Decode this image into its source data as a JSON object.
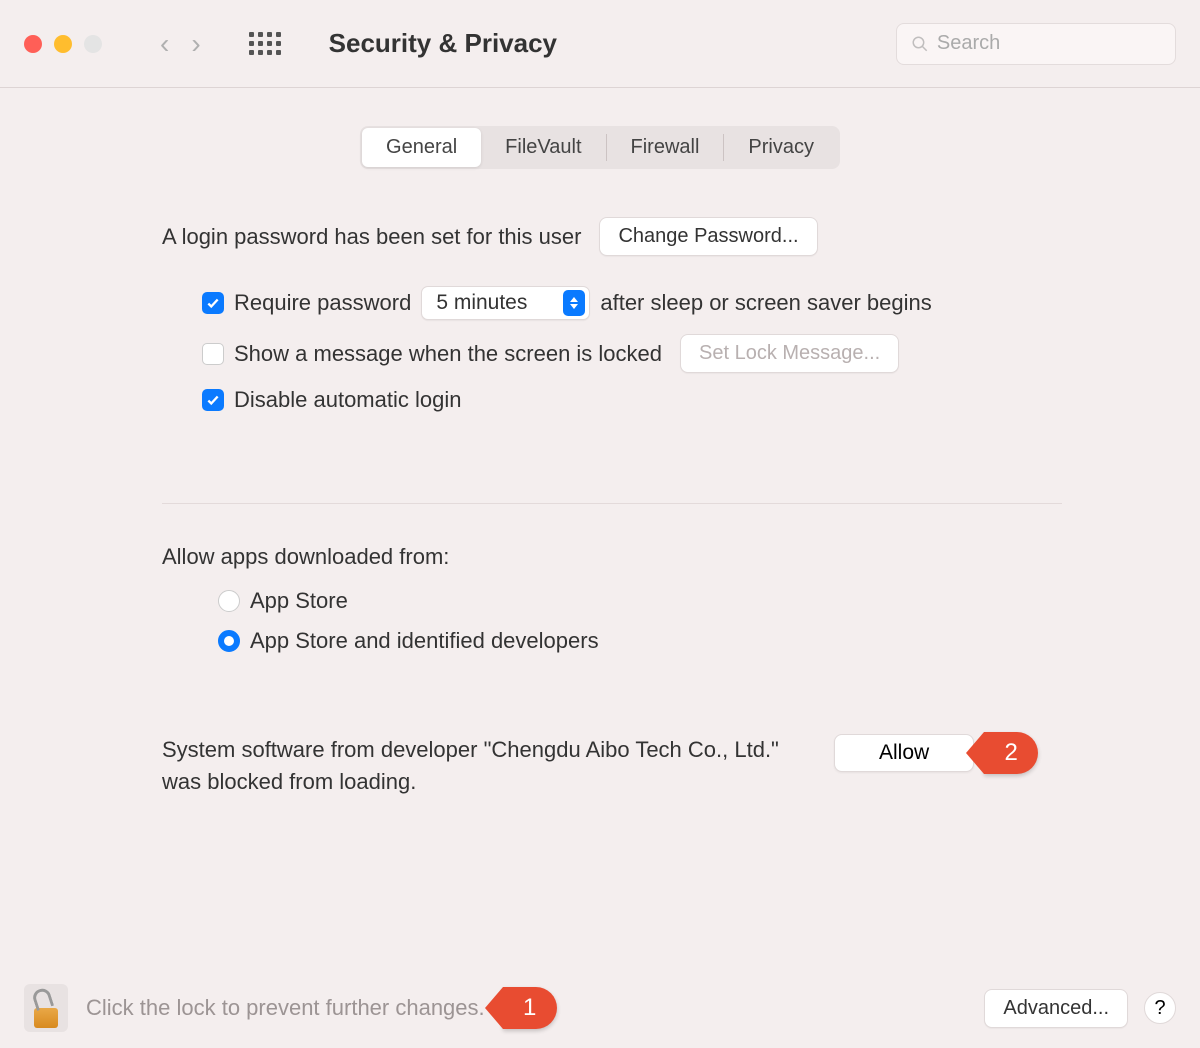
{
  "window": {
    "title": "Security & Privacy",
    "search_placeholder": "Search"
  },
  "tabs": {
    "general": "General",
    "filevault": "FileVault",
    "firewall": "Firewall",
    "privacy": "Privacy",
    "active": "general"
  },
  "general": {
    "login_password_text": "A login password has been set for this user",
    "change_password_btn": "Change Password...",
    "require_password_label": "Require password",
    "require_password_delay": "5 minutes",
    "require_password_suffix": "after sleep or screen saver begins",
    "require_password_checked": true,
    "show_message_label": "Show a message when the screen is locked",
    "show_message_checked": false,
    "set_lock_message_btn": "Set Lock Message...",
    "disable_auto_login_label": "Disable automatic login",
    "disable_auto_login_checked": true,
    "allow_apps_heading": "Allow apps downloaded from:",
    "radio_appstore": "App Store",
    "radio_identified": "App Store and identified developers",
    "radio_selected": "identified",
    "blocked_text": "System software from developer \"Chengdu Aibo Tech Co., Ltd.\" was blocked from loading.",
    "allow_btn": "Allow"
  },
  "footer": {
    "text": "Click the lock to prevent further changes.",
    "advanced_btn": "Advanced...",
    "help": "?"
  },
  "annotations": {
    "callout1": "1",
    "callout2": "2"
  }
}
